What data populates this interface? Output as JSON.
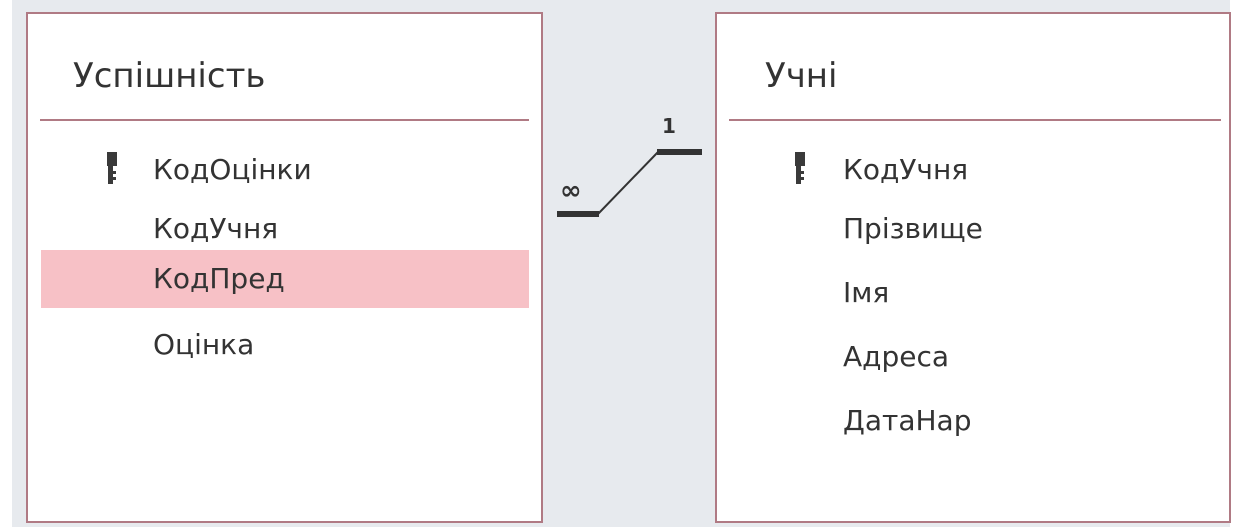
{
  "tables": [
    {
      "title": "Успішність",
      "fields": [
        {
          "label": "КодОцінки",
          "primary_key": true,
          "selected": false
        },
        {
          "label": "КодУчня",
          "primary_key": false,
          "selected": false
        },
        {
          "label": "КодПред",
          "primary_key": false,
          "selected": true
        },
        {
          "label": "Оцінка",
          "primary_key": false,
          "selected": false
        }
      ]
    },
    {
      "title": "Учні",
      "fields": [
        {
          "label": "КодУчня",
          "primary_key": true,
          "selected": false
        },
        {
          "label": "Прізвище",
          "primary_key": false,
          "selected": false
        },
        {
          "label": "Імя",
          "primary_key": false,
          "selected": false
        },
        {
          "label": "Адреса",
          "primary_key": false,
          "selected": false
        },
        {
          "label": "ДатаНар",
          "primary_key": false,
          "selected": false
        }
      ]
    }
  ],
  "relationship": {
    "one_side_label": "1",
    "many_side_label": "∞"
  },
  "colors": {
    "canvas": "#e7eaee",
    "table_border": "#b07a84",
    "selected_row": "#f7c1c6",
    "text": "#333333"
  },
  "icons": {
    "primary_key": "key-icon"
  }
}
